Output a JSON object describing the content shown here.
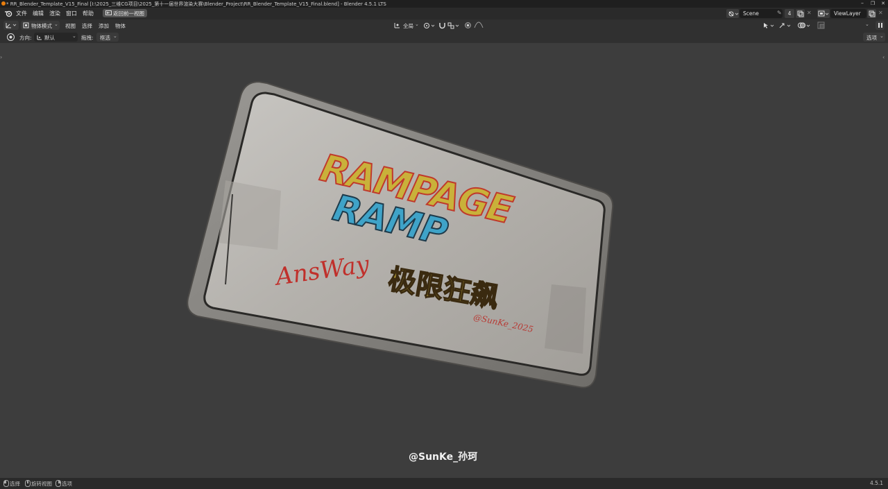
{
  "window": {
    "title": "* RR_Blender_Template_V15_Final [I:\\2025_三维CG项目\\2025_第十一届世界渲染大赛\\Blender_Project\\RR_Blender_Template_V15_Final.blend] - Blender 4.5.1 LTS",
    "minimize": "–",
    "maximize": "❐",
    "close": "✕"
  },
  "menubar": {
    "items": [
      "文件",
      "编辑",
      "渲染",
      "窗口",
      "帮助"
    ],
    "back_button": "返回前一视图",
    "scene": "Scene",
    "scene_users": "4",
    "view_layer": "ViewLayer"
  },
  "header": {
    "mode": "物体模式",
    "menus": [
      "视图",
      "选择",
      "添加",
      "物体"
    ],
    "transform_orientation": "全局"
  },
  "tool_settings": {
    "orientation_label": "方向:",
    "orientation_value": "默认",
    "drag_label": "拖拽:",
    "drag_value": "框选",
    "options": "选项"
  },
  "viewport": {
    "sign_line1": "RAMPAGE",
    "sign_line2": "RAMP",
    "sign_chinese": "极限狂飙",
    "signature": "AnsWay",
    "small_signature": "@SunKe_2025",
    "watermark": "@SunKe_孙珂"
  },
  "statusbar": {
    "select": "选择",
    "rotate_view": "旋转视图",
    "options": "选项",
    "version": "4.5.1"
  },
  "colors": {
    "title_bg": "#1f1f1f",
    "menu_bg": "#2a2a2a",
    "header_bg": "#303030",
    "viewport_bg": "#3d3d3d",
    "accent_blue": "#4772b3"
  }
}
